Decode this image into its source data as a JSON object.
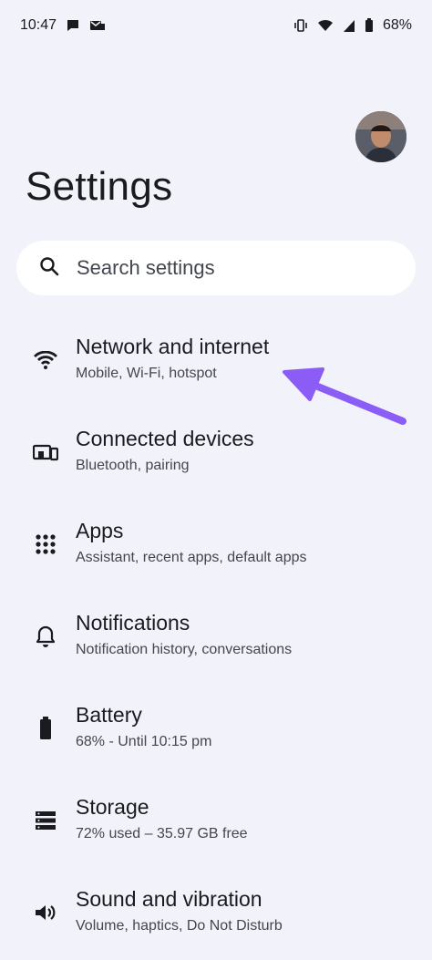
{
  "status": {
    "time": "10:47",
    "battery": "68%"
  },
  "header": {
    "title": "Settings"
  },
  "search": {
    "placeholder": "Search settings"
  },
  "items": [
    {
      "title": "Network and internet",
      "subtitle": "Mobile, Wi-Fi, hotspot",
      "icon": "wifi-icon"
    },
    {
      "title": "Connected devices",
      "subtitle": "Bluetooth, pairing",
      "icon": "devices-icon"
    },
    {
      "title": "Apps",
      "subtitle": "Assistant, recent apps, default apps",
      "icon": "apps-grid-icon"
    },
    {
      "title": "Notifications",
      "subtitle": "Notification history, conversations",
      "icon": "bell-icon"
    },
    {
      "title": "Battery",
      "subtitle": "68% - Until 10:15 pm",
      "icon": "battery-icon"
    },
    {
      "title": "Storage",
      "subtitle": "72% used – 35.97 GB free",
      "icon": "storage-icon"
    },
    {
      "title": "Sound and vibration",
      "subtitle": "Volume, haptics, Do Not Disturb",
      "icon": "speaker-icon"
    }
  ],
  "colors": {
    "background": "#f1f2fa",
    "annotation_arrow": "#8b5cf6"
  }
}
